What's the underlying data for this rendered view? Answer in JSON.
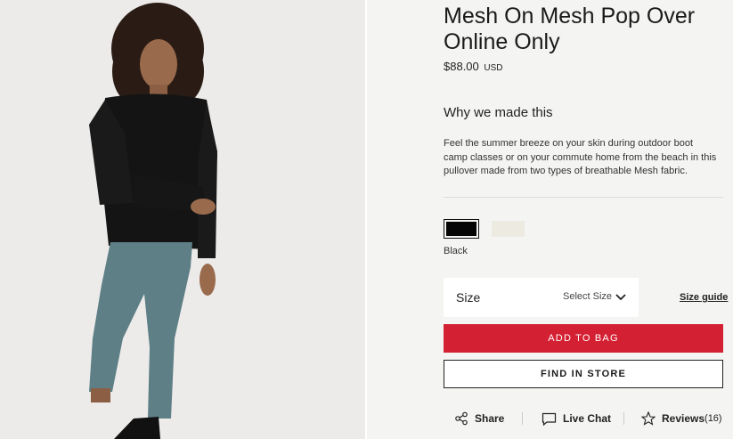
{
  "product": {
    "title": "Mesh On Mesh Pop Over Online Only",
    "price": "$88.00",
    "currency": "USD",
    "why_heading": "Why we made this",
    "description": "Feel the summer breeze on your skin during outdoor boot camp classes or on your commute home from the beach in this pullover made from two types of breathable Mesh fabric."
  },
  "colors": {
    "swatches": [
      {
        "name": "Black",
        "hex": "#050505",
        "selected": true
      },
      {
        "name": "white-swatch",
        "hex": "#eceae1",
        "selected": false
      }
    ],
    "selected_name": "Black"
  },
  "size": {
    "label": "Size",
    "select_placeholder": "Select Size",
    "guide_link": "Size guide"
  },
  "buttons": {
    "add_to_bag": "ADD TO BAG",
    "find_in_store": "FIND IN STORE"
  },
  "actions": {
    "share": "Share",
    "live_chat": "Live Chat",
    "reviews_label": "Reviews",
    "reviews_count": "(16)"
  },
  "theme": {
    "accent_red": "#d42033",
    "panel_bg": "#f4f4f3"
  }
}
